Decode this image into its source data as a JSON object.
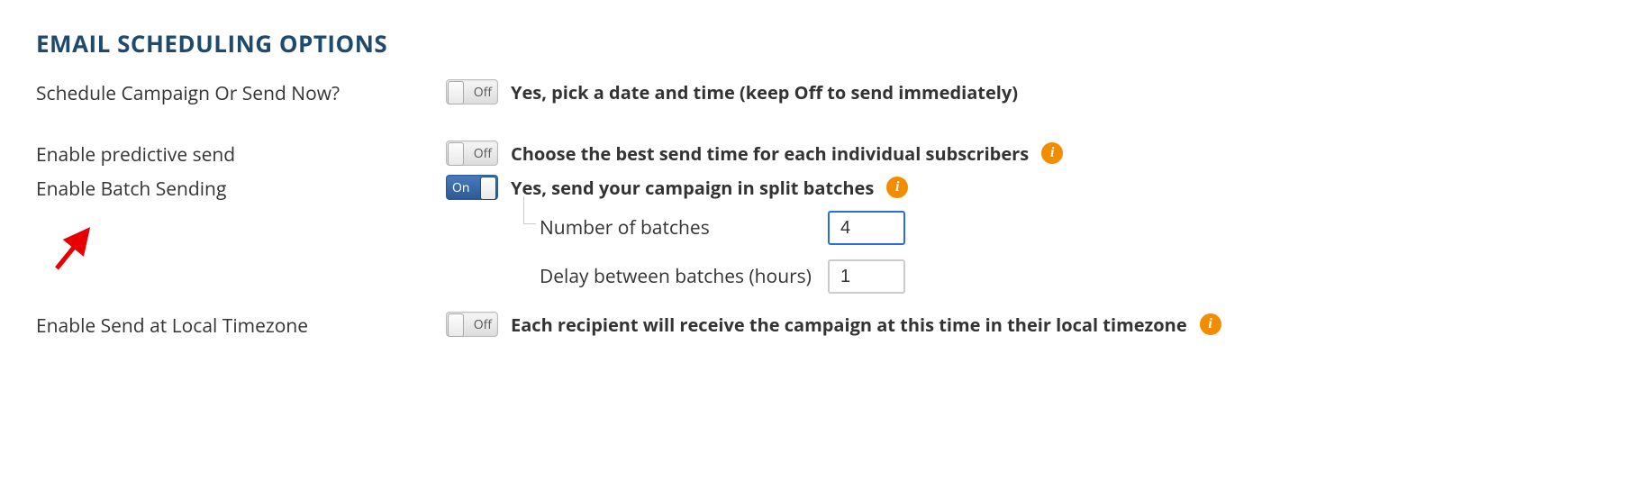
{
  "section_title": "EMAIL SCHEDULING OPTIONS",
  "toggle": {
    "on_label": "On",
    "off_label": "Off"
  },
  "rows": {
    "schedule": {
      "label": "Schedule Campaign Or Send Now?",
      "state": "off",
      "desc": "Yes, pick a date and time (keep Off to send immediately)"
    },
    "predictive": {
      "label": "Enable predictive send",
      "state": "off",
      "desc": "Choose the best send time for each individual subscribers"
    },
    "batch": {
      "label": "Enable Batch Sending",
      "state": "on",
      "desc": "Yes, send your campaign in split batches",
      "sub": {
        "num_label": "Number of batches",
        "num_value": "4",
        "delay_label": "Delay between batches (hours)",
        "delay_value": "1"
      }
    },
    "timezone": {
      "label": "Enable Send at Local Timezone",
      "state": "off",
      "desc": "Each recipient will receive the campaign at this time in their local timezone"
    }
  }
}
